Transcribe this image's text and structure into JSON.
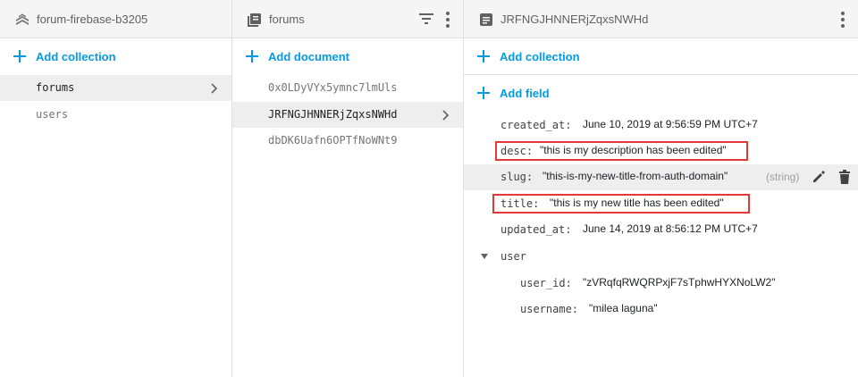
{
  "panel1": {
    "title": "forum-firebase-b3205",
    "icon": "firestore-logo-icon",
    "add_label": "Add collection",
    "collections": [
      "forums",
      "users"
    ],
    "selected": "forums"
  },
  "panel2": {
    "title": "forums",
    "icon": "collection-icon",
    "add_label": "Add document",
    "documents": [
      "0x0LDyVYx5ymnc7lmUls",
      "JRFNGJHNNERjZqxsNWHd",
      "dbDK6Uafn6OPTfNoWNt9"
    ],
    "selected": "JRFNGJHNNERjZqxsNWHd"
  },
  "panel3": {
    "title": "JRFNGJHNNERjZqxsNWHd",
    "icon": "document-icon",
    "add_collection_label": "Add collection",
    "add_field_label": "Add field",
    "fields": {
      "created_at": {
        "key": "created_at:",
        "value": "June 10, 2019 at 9:56:59 PM UTC+7"
      },
      "desc": {
        "key": "desc:",
        "value": "\"this is my description has been edited\""
      },
      "slug": {
        "key": "slug:",
        "value": "\"this-is-my-new-title-from-auth-domain\"",
        "type": "(string)"
      },
      "title": {
        "key": "title:",
        "value": "\"this is my new title has been edited\""
      },
      "updated_at": {
        "key": "updated_at:",
        "value": "June 14, 2019 at 8:56:12 PM UTC+7"
      },
      "user": {
        "key": "user"
      },
      "user_id": {
        "key": "user_id:",
        "value": "\"zVRqfqRWQRPxjF7sTphwHYXNoLW2\""
      },
      "username": {
        "key": "username:",
        "value": "\"milea laguna\""
      }
    }
  },
  "colors": {
    "accent": "#039be5",
    "highlight_box": "#e53935",
    "selected_row": "#eeeeee"
  }
}
